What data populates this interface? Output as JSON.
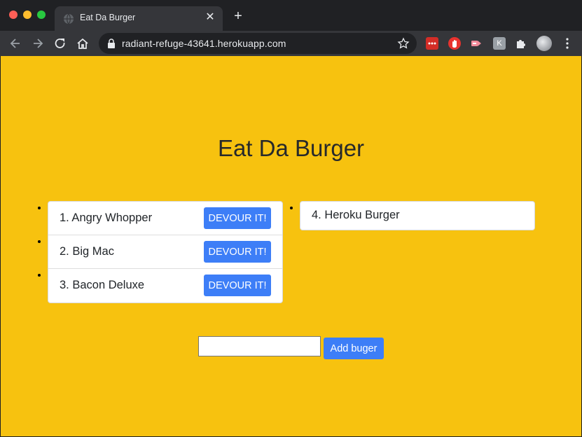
{
  "browser": {
    "tab_title": "Eat Da Burger",
    "tab_close": "✕",
    "new_tab": "+",
    "url": "radiant-refuge-43641.herokuapp.com",
    "ext_k_label": "K"
  },
  "page": {
    "title": "Eat Da Burger",
    "background_color": "#f7c20f",
    "button_color": "#3d7ef7"
  },
  "burgers_uneaten": [
    {
      "label": "1. Angry Whopper",
      "button": "DEVOUR IT!"
    },
    {
      "label": "2. Big Mac",
      "button": "DEVOUR IT!"
    },
    {
      "label": "3. Bacon Deluxe",
      "button": "DEVOUR IT!"
    }
  ],
  "burgers_devoured": [
    {
      "label": "4. Heroku Burger"
    }
  ],
  "form": {
    "input_value": "",
    "input_placeholder": "",
    "submit_label": "Add buger"
  }
}
